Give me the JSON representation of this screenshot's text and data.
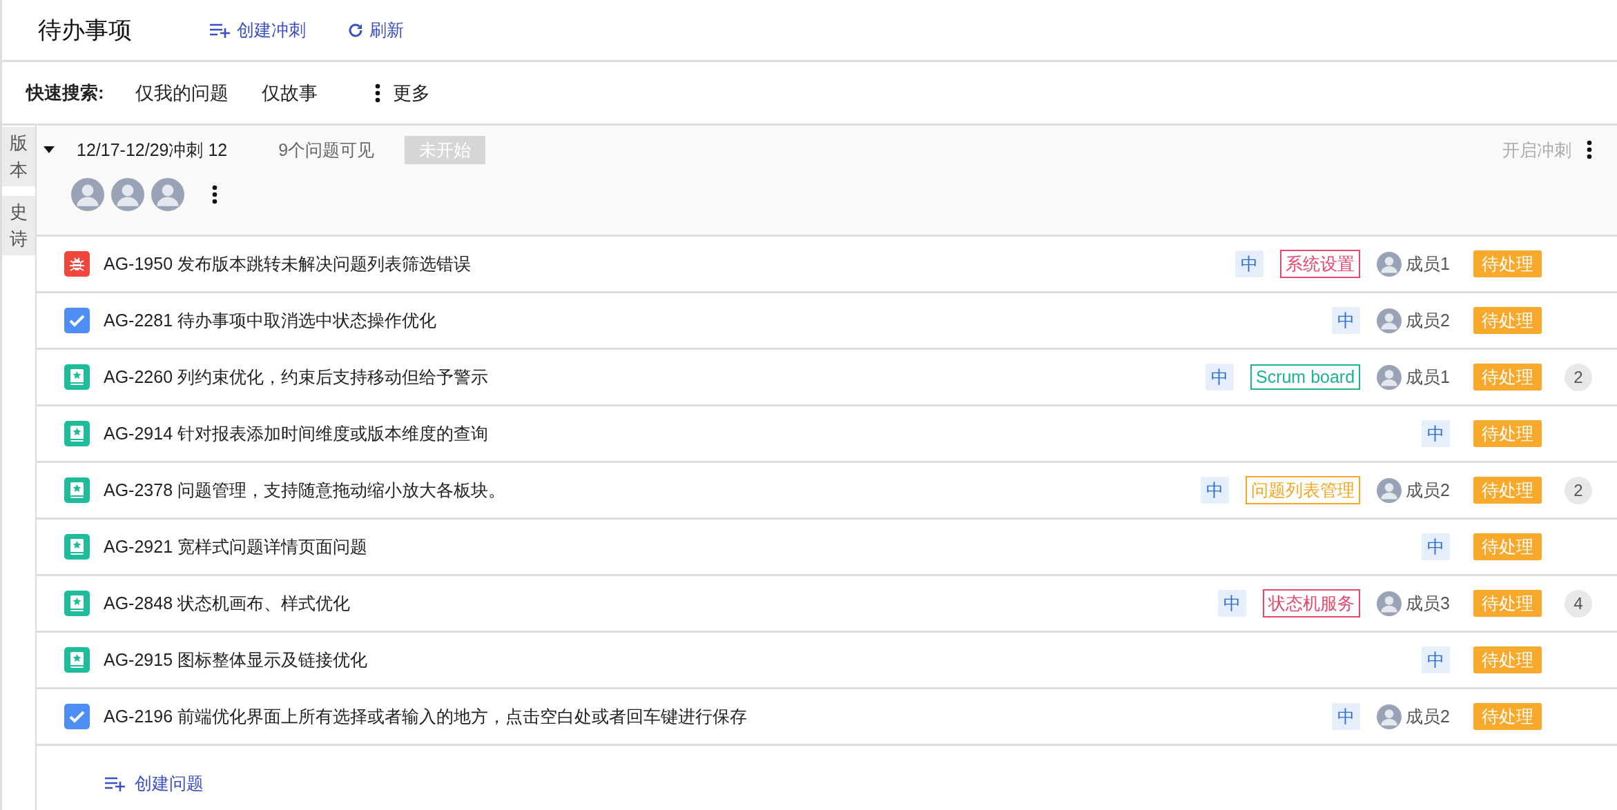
{
  "header": {
    "title": "待办事项",
    "actions": [
      {
        "kind": "create",
        "label": "创建冲刺"
      },
      {
        "kind": "refresh",
        "label": "刷新"
      }
    ]
  },
  "quick_search": {
    "label": "快速搜索:",
    "filters": [
      "仅我的问题",
      "仅故事"
    ],
    "more": "更多"
  },
  "side_tabs": [
    {
      "label": "版本",
      "selected": false
    },
    {
      "label": "史诗",
      "selected": false
    }
  ],
  "sprint": {
    "expanded": true,
    "title": "12/17-12/29冲刺 12",
    "count": "9个问题可见",
    "status": "未开始",
    "start_button": {
      "label": "开启冲刺",
      "disabled": true
    },
    "member_avatars": [
      {
        "kind": "avatar"
      },
      {
        "kind": "avatar"
      },
      {
        "kind": "avatar"
      }
    ]
  },
  "issues": [
    {
      "kind": "bug",
      "key": "AG-1950",
      "title": "发布版本跳转未解决问题列表筛选错误",
      "priority": "中",
      "epic": {
        "label": "系统设置",
        "color": "#e8466a"
      },
      "assignee": "成员1",
      "status": "待处理"
    },
    {
      "kind": "task",
      "key": "AG-2281",
      "title": "待办事项中取消选中状态操作优化",
      "priority": "中",
      "assignee": "成员2",
      "status": "待处理"
    },
    {
      "kind": "story",
      "key": "AG-2260",
      "title": "列约束优化，约束后支持移动但给予警示",
      "priority": "中",
      "epic": {
        "label": "Scrum board",
        "color": "#1bb394"
      },
      "assignee": "成员1",
      "status": "待处理",
      "comments": "2"
    },
    {
      "kind": "story",
      "key": "AG-2914",
      "title": "针对报表添加时间维度或版本维度的查询",
      "priority": "中",
      "status": "待处理"
    },
    {
      "kind": "story",
      "key": "AG-2378",
      "title": "问题管理，支持随意拖动缩小放大各板块。",
      "priority": "中",
      "epic": {
        "label": "问题列表管理",
        "color": "#f5a623"
      },
      "assignee": "成员2",
      "status": "待处理",
      "comments": "2"
    },
    {
      "kind": "story",
      "key": "AG-2921",
      "title": "宽样式问题详情页面问题",
      "priority": "中",
      "status": "待处理"
    },
    {
      "kind": "story",
      "key": "AG-2848",
      "title": "状态机画布、样式优化",
      "priority": "中",
      "epic": {
        "label": "状态机服务",
        "color": "#e8466a"
      },
      "assignee": "成员3",
      "status": "待处理",
      "comments": "4"
    },
    {
      "kind": "story",
      "key": "AG-2915",
      "title": "图标整体显示及链接优化",
      "priority": "中",
      "status": "待处理"
    },
    {
      "kind": "task",
      "key": "AG-2196",
      "title": "前端优化界面上所有选择或者输入的地方，点击空白处或者回车键进行保存",
      "priority": "中",
      "assignee": "成员2",
      "status": "待处理"
    }
  ],
  "create_issue": "创建问题"
}
